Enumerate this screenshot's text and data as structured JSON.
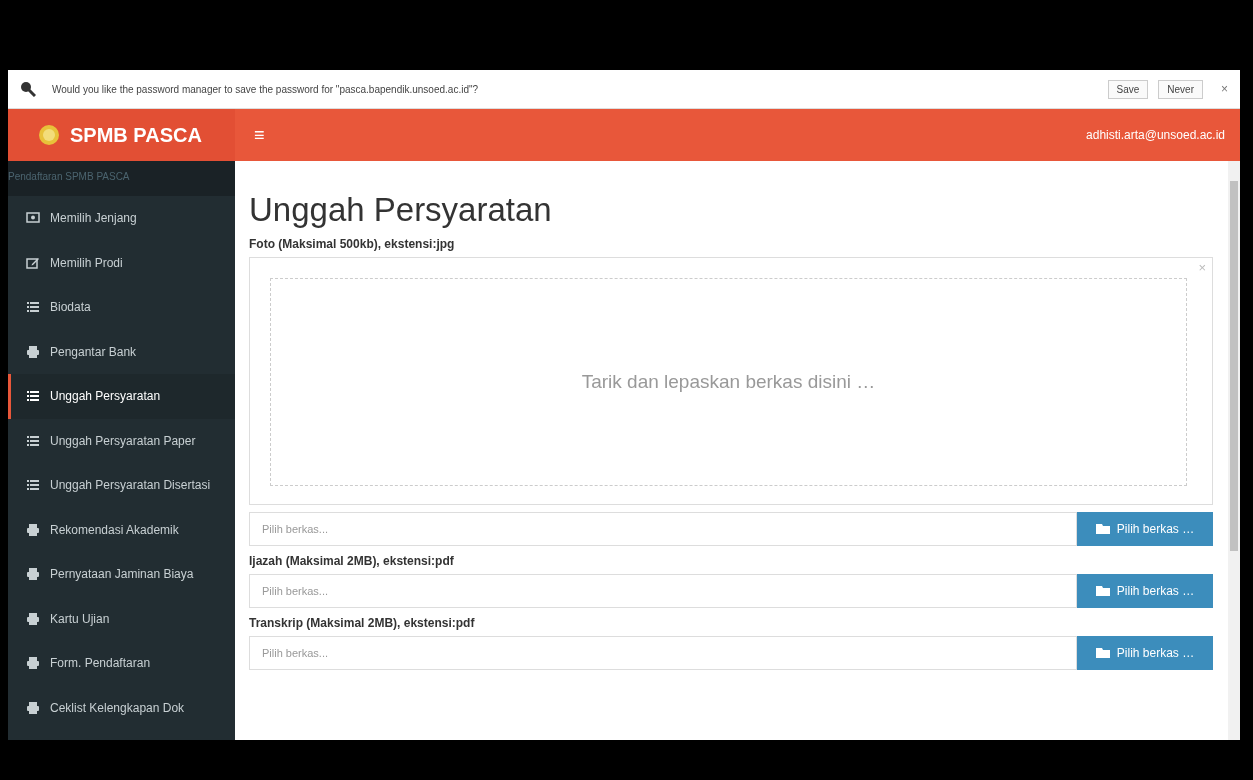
{
  "password_bar": {
    "message": "Would you like the password manager to save the password for \"pasca.bapendik.unsoed.ac.id\"?",
    "buttons": [
      "Save",
      "Never"
    ],
    "close": "×"
  },
  "header": {
    "brand": "SPMB PASCA",
    "menu_toggle": "≡",
    "user": "adhisti.arta@unsoed.ac.id"
  },
  "sidebar": {
    "heading": "Pendaftaran SPMB PASCA",
    "items": [
      {
        "label": "Memilih Jenjang",
        "kind": "money",
        "selected": false
      },
      {
        "label": "Memilih Prodi",
        "kind": "edit",
        "selected": false
      },
      {
        "label": "Biodata",
        "kind": "list",
        "selected": false
      },
      {
        "label": "Pengantar Bank",
        "kind": "print",
        "selected": false
      },
      {
        "label": "Unggah Persyaratan",
        "kind": "list",
        "selected": true
      },
      {
        "label": "Unggah Persyaratan Paper",
        "kind": "list",
        "selected": false
      },
      {
        "label": "Unggah Persyaratan Disertasi",
        "kind": "list",
        "selected": false
      },
      {
        "label": "Rekomendasi Akademik",
        "kind": "print",
        "selected": false
      },
      {
        "label": "Pernyataan Jaminan Biaya",
        "kind": "print",
        "selected": false
      },
      {
        "label": "Kartu Ujian",
        "kind": "print",
        "selected": false
      },
      {
        "label": "Form. Pendaftaran",
        "kind": "print",
        "selected": false
      },
      {
        "label": "Ceklist Kelengkapan Dok",
        "kind": "print",
        "selected": false
      }
    ]
  },
  "content": {
    "title": "Unggah Persyaratan",
    "uploads": [
      {
        "label": "Foto (Maksimal 500kb), ekstensi:jpg",
        "dropzone": {
          "text": "Tarik dan lepaskan berkas disini …",
          "close": "×"
        },
        "placeholder": "Pilih berkas...",
        "button": "Pilih berkas …"
      },
      {
        "label": "Ijazah (Maksimal 2MB), ekstensi:pdf",
        "placeholder": "Pilih berkas...",
        "button": "Pilih berkas …"
      },
      {
        "label": "Transkrip (Maksimal 2MB), ekstensi:pdf",
        "placeholder": "Pilih berkas...",
        "button": "Pilih berkas …"
      }
    ]
  }
}
